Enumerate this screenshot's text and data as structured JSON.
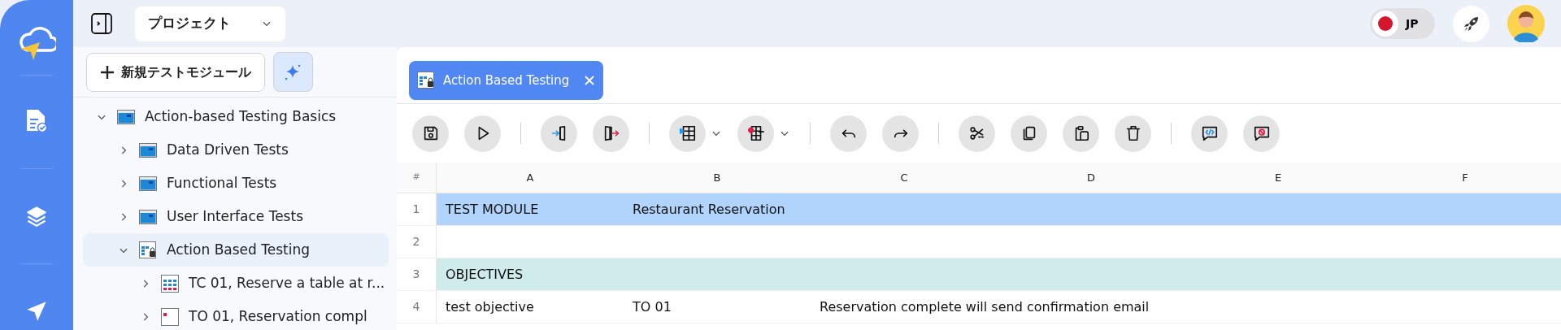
{
  "project_selector": {
    "label": "プロジェクト"
  },
  "language": {
    "label": "JP"
  },
  "sidebar": {
    "new_button": "新規テストモジュール",
    "tree": [
      {
        "label": "Action-based Testing Basics",
        "kind": "folder",
        "expanded": true,
        "selected": false,
        "children": [
          {
            "label": "Data Driven Tests",
            "kind": "folder",
            "expanded": false,
            "selected": false
          },
          {
            "label": "Functional Tests",
            "kind": "folder",
            "expanded": false,
            "selected": false
          },
          {
            "label": "User Interface Tests",
            "kind": "folder",
            "expanded": false,
            "selected": false
          },
          {
            "label": "Action Based Testing",
            "kind": "module",
            "expanded": true,
            "selected": true,
            "children": [
              {
                "label": "TC 01, Reserve a table at r...",
                "kind": "testcase",
                "expanded": false,
                "selected": false
              },
              {
                "label": "TO 01, Reservation compl",
                "kind": "objective",
                "expanded": false,
                "selected": false
              }
            ]
          }
        ]
      }
    ]
  },
  "tabs": [
    {
      "label": "Action Based Testing",
      "selected": true
    }
  ],
  "toolbar": [
    {
      "items": [
        {
          "kind": "save"
        },
        {
          "kind": "run"
        }
      ]
    },
    {
      "items": [
        {
          "kind": "import"
        },
        {
          "kind": "export"
        }
      ]
    },
    {
      "items": [
        {
          "kind": "insert-row"
        },
        {
          "kind": "delete-row"
        }
      ]
    },
    {
      "items": [
        {
          "kind": "undo"
        },
        {
          "kind": "redo"
        }
      ]
    },
    {
      "items": [
        {
          "kind": "cut"
        },
        {
          "kind": "copy"
        },
        {
          "kind": "paste"
        },
        {
          "kind": "delete"
        }
      ]
    },
    {
      "items": [
        {
          "kind": "comment"
        },
        {
          "kind": "uncomment"
        }
      ]
    }
  ],
  "table": {
    "row_number_header": "#",
    "columns": [
      "A",
      "B",
      "C",
      "D",
      "E",
      "F"
    ],
    "rows": [
      {
        "number": "1",
        "kind": "module",
        "cells": [
          "TEST MODULE",
          "Restaurant Reservation"
        ]
      },
      {
        "number": "2",
        "kind": "empty",
        "cells": []
      },
      {
        "number": "3",
        "kind": "section",
        "cells": [
          "OBJECTIVES"
        ]
      },
      {
        "number": "4",
        "kind": "plain",
        "cells": [
          "test objective",
          "TO 01",
          "Reservation complete will send confirmation email"
        ]
      }
    ]
  }
}
